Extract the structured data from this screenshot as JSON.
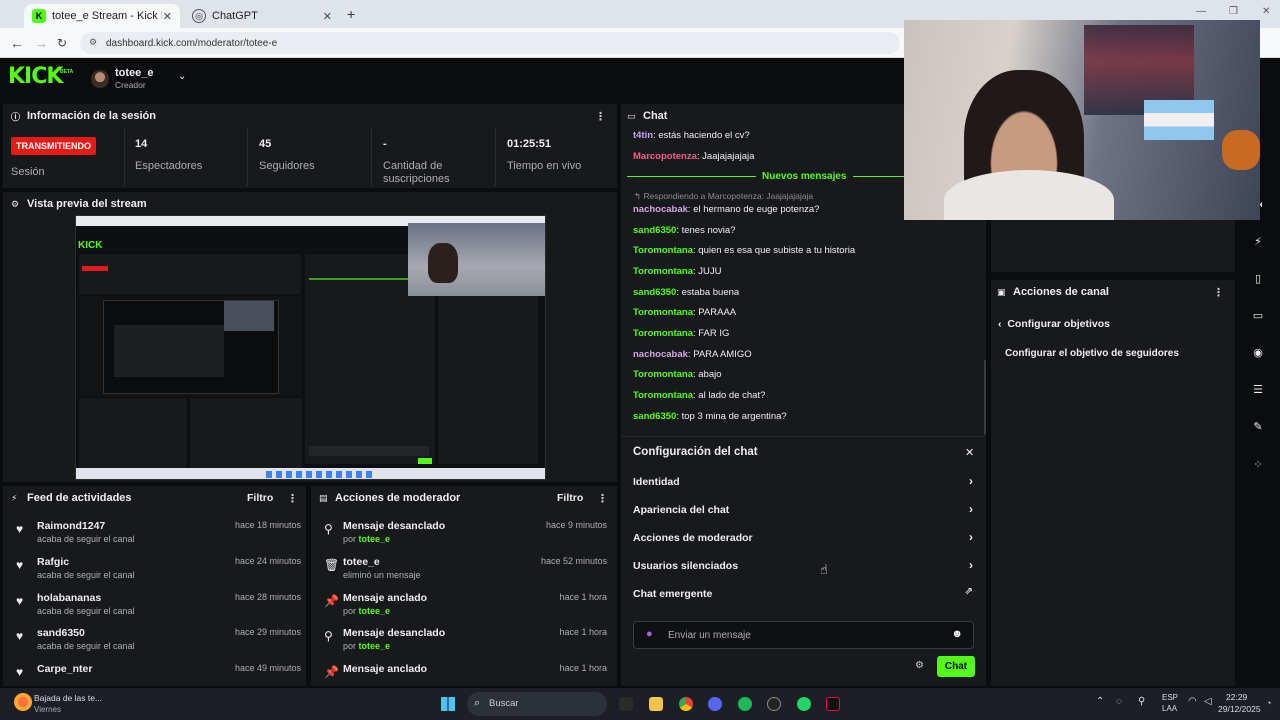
{
  "browser": {
    "tabs": [
      {
        "title": "totee_e Stream - Kick Dashbo",
        "active": true
      },
      {
        "title": "ChatGPT",
        "active": false
      }
    ],
    "new_tab": "+",
    "url": "dashboard.kick.com/moderator/totee-e"
  },
  "header": {
    "logo": "KICK",
    "beta": "BETA",
    "username": "totee_e",
    "role": "Creador"
  },
  "session": {
    "title": "Información de la sesión",
    "status_badge": "TRANSMITIENDO",
    "status_label": "Sesión",
    "stats": [
      {
        "value": "14",
        "label": "Espectadores"
      },
      {
        "value": "45",
        "label": "Seguidores"
      },
      {
        "value": "-",
        "label": "Cantidad de suscripciones"
      },
      {
        "value": "01:25:51",
        "label": "Tiempo en vivo"
      }
    ]
  },
  "preview": {
    "title": "Vista previa del stream"
  },
  "activity": {
    "title": "Feed de actividades",
    "filter": "Filtro",
    "items": [
      {
        "name": "Raimond1247",
        "text": "acaba de seguir el canal",
        "time": "hace 18 minutos"
      },
      {
        "name": "Rafgic",
        "text": "acaba de seguir el canal",
        "time": "hace 24 minutos"
      },
      {
        "name": "holabananas",
        "text": "acaba de seguir el canal",
        "time": "hace 28 minutos"
      },
      {
        "name": "sand6350",
        "text": "acaba de seguir el canal",
        "time": "hace 29 minutos"
      },
      {
        "name": "Carpe_nter",
        "text": "",
        "time": "hace 49 minutos"
      }
    ]
  },
  "modactions": {
    "title": "Acciones de moderador",
    "filter": "Filtro",
    "items": [
      {
        "icon": "unpin",
        "title": "Mensaje desanclado",
        "by": "por",
        "user": "totee_e",
        "time": "hace 9 minutos"
      },
      {
        "icon": "trash",
        "title": "totee_e",
        "by": "eliminó un mensaje",
        "user": "",
        "time": "hace 52 minutos"
      },
      {
        "icon": "pin",
        "title": "Mensaje anclado",
        "by": "por",
        "user": "totee_e",
        "time": "hace 1 hora"
      },
      {
        "icon": "unpin",
        "title": "Mensaje desanclado",
        "by": "por",
        "user": "totee_e",
        "time": "hace 1 hora"
      },
      {
        "icon": "pin",
        "title": "Mensaje anclado",
        "by": "",
        "user": "",
        "time": "hace 1 hora"
      }
    ]
  },
  "chat": {
    "title": "Chat",
    "messages_top": [
      {
        "user": "t4tin",
        "text": "estás haciendo el cv?",
        "color": "#c7a3f5"
      },
      {
        "user": "Marcopotenza",
        "text": "Jaajajajajaja",
        "color": "#ff5c8a"
      }
    ],
    "new_messages": "Nuevos mensajes",
    "reply_note": "Respondiendo a Marcopotenza: Jaajajajajaja",
    "messages": [
      {
        "user": "nachocabak",
        "text": "el hermano de euge potenza?",
        "color": "#d3a6e8"
      },
      {
        "user": "sand6350",
        "text": "tenes novia?",
        "color": "#53fc18"
      },
      {
        "user": "Toromontana",
        "text": "quien es esa que subiste a tu historia",
        "color": "#53fc18"
      },
      {
        "user": "Toromontana",
        "text": "JUJU",
        "color": "#53fc18"
      },
      {
        "user": "sand6350",
        "text": "estaba buena",
        "color": "#53fc18"
      },
      {
        "user": "Toromontana",
        "text": "PARAAA",
        "color": "#53fc18"
      },
      {
        "user": "Toromontana",
        "text": "FAR IG",
        "color": "#53fc18"
      },
      {
        "user": "nachocabak",
        "text": "PARA AMIGO",
        "color": "#d3a6e8"
      },
      {
        "user": "Toromontana",
        "text": "abajo",
        "color": "#53fc18"
      },
      {
        "user": "Toromontana",
        "text": "al lado de chat?",
        "color": "#53fc18"
      },
      {
        "user": "sand6350",
        "text": "top 3 mina de argentina?",
        "color": "#53fc18"
      }
    ],
    "settings": {
      "title": "Configuración del chat",
      "items": [
        "Identidad",
        "Apariencia del chat",
        "Acciones de moderador",
        "Usuarios silenciados",
        "Chat emergente"
      ]
    },
    "input_placeholder": "Enviar un mensaje",
    "send_label": "Chat"
  },
  "channel_actions": {
    "title": "Acciones de canal",
    "back_label": "Configurar objetivos",
    "item": "Configurar el objetivo de seguidores"
  },
  "taskbar": {
    "weather_line1": "Bajada de las te...",
    "weather_line2": "Viernes",
    "search": "Buscar",
    "lang1": "ESP",
    "lang2": "LAA",
    "time": "22:29",
    "date": "29/12/2025"
  },
  "colors": {
    "accent": "#53fc18",
    "live_red": "#e91916",
    "panel": "#18191b",
    "bg": "#0b0c0d"
  }
}
